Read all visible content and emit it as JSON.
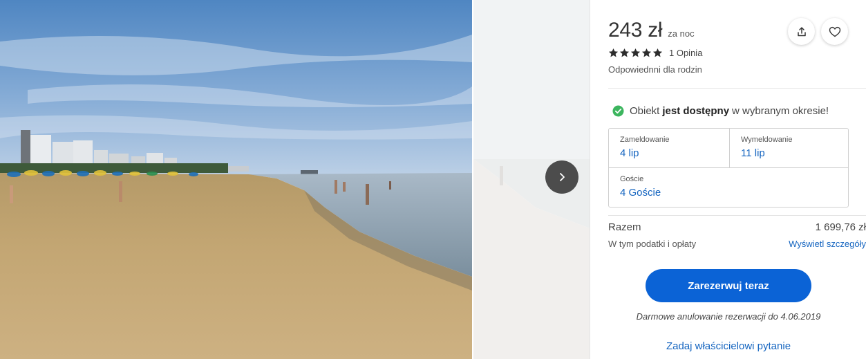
{
  "gallery": {
    "main_photo": "beach-photo",
    "next_photo": "beach-photo-next",
    "next_button_icon": "chevron-right-icon"
  },
  "listing": {
    "price": "243 zł",
    "price_unit": "za noc",
    "rating_stars": 5,
    "rating_max": 5,
    "reviews": "1 Opinia",
    "family_tag": "Odpowiednni dla rodzin"
  },
  "actions": {
    "share_icon": "share-icon",
    "favorite_icon": "heart-icon"
  },
  "availability": {
    "prefix": "Obiekt",
    "status": "jest dostępny",
    "suffix": "w wybranym okresie!",
    "icon": "check-circle-icon",
    "icon_color": "#3cb55e"
  },
  "dates": {
    "checkin_label": "Zameldowanie",
    "checkin_value": "4 lip",
    "checkout_label": "Wymeldowanie",
    "checkout_value": "11 lip",
    "guests_label": "Goście",
    "guests_value": "4 Goście"
  },
  "summary": {
    "total_label": "Razem",
    "total_value": "1 699,76 zł",
    "tax_label": "W tym podatki i opłaty",
    "details_link": "Wyświetl szczegóły"
  },
  "cta": {
    "book_label": "Zarezerwuj teraz",
    "button_color": "#0b63d6",
    "cancellation_note": "Darmowe anulowanie rezerwacji do 4.06.2019",
    "ask_owner": "Zadaj właścicielowi pytanie"
  },
  "colors": {
    "link": "#1565c0",
    "star": "#2d2d2d"
  }
}
